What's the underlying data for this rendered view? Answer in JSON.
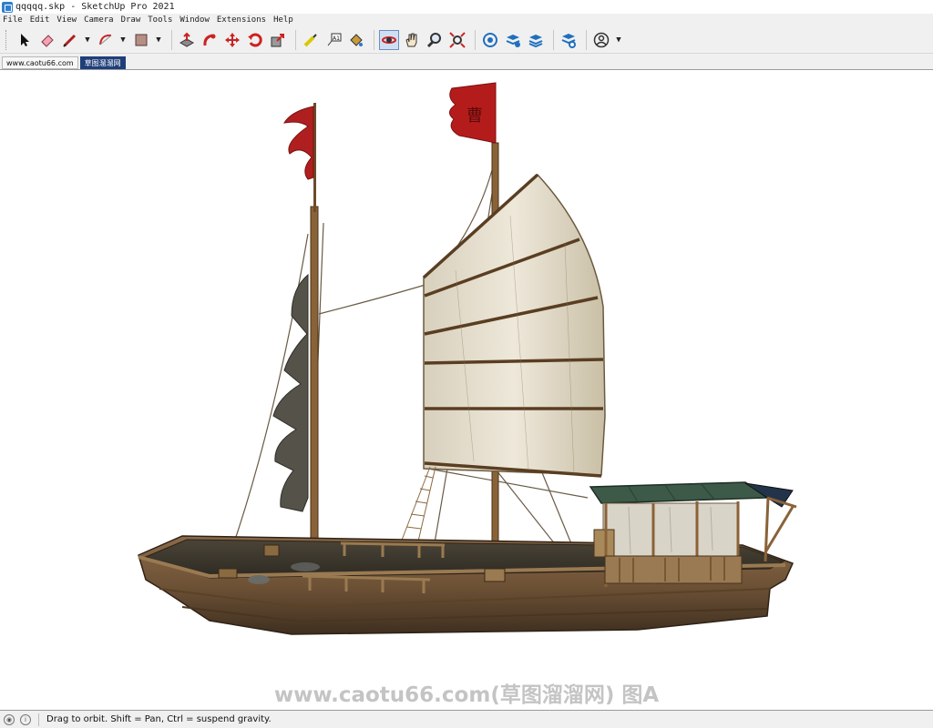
{
  "window": {
    "title": "qqqqq.skp - SketchUp Pro 2021"
  },
  "menu": [
    "File",
    "Edit",
    "View",
    "Camera",
    "Draw",
    "Tools",
    "Window",
    "Extensions",
    "Help"
  ],
  "toolbar": {
    "tools": [
      {
        "name": "select-icon"
      },
      {
        "name": "eraser-icon"
      },
      {
        "name": "line-icon",
        "dropdown": true
      },
      {
        "name": "arc-icon",
        "dropdown": true
      },
      {
        "name": "rectangle-icon",
        "dropdown": true
      },
      {
        "name": "push-pull-icon"
      },
      {
        "name": "follow-me-icon"
      },
      {
        "name": "move-icon"
      },
      {
        "name": "rotate-icon"
      },
      {
        "name": "scale-icon"
      },
      {
        "name": "tape-measure-icon"
      },
      {
        "name": "text-icon"
      },
      {
        "name": "paint-bucket-icon"
      },
      {
        "name": "orbit-icon",
        "active": true
      },
      {
        "name": "pan-icon"
      },
      {
        "name": "zoom-icon"
      },
      {
        "name": "zoom-extents-icon"
      },
      {
        "name": "3d-warehouse-icon"
      },
      {
        "name": "extension-warehouse-icon"
      },
      {
        "name": "layout-icon"
      },
      {
        "name": "extension-manager-icon"
      },
      {
        "name": "account-icon",
        "dropdown": true
      }
    ],
    "accent": "#cc2222"
  },
  "tabs": [
    {
      "label": "www.caotu66.com",
      "active": false
    },
    {
      "label": "草图溜溜网",
      "active": true
    }
  ],
  "viewport": {
    "watermark": "www.caotu66.com(草图溜溜网) 图A",
    "flag_glyph": "曹"
  },
  "status": {
    "text": "Drag to orbit. Shift = Pan, Ctrl = suspend gravity."
  }
}
